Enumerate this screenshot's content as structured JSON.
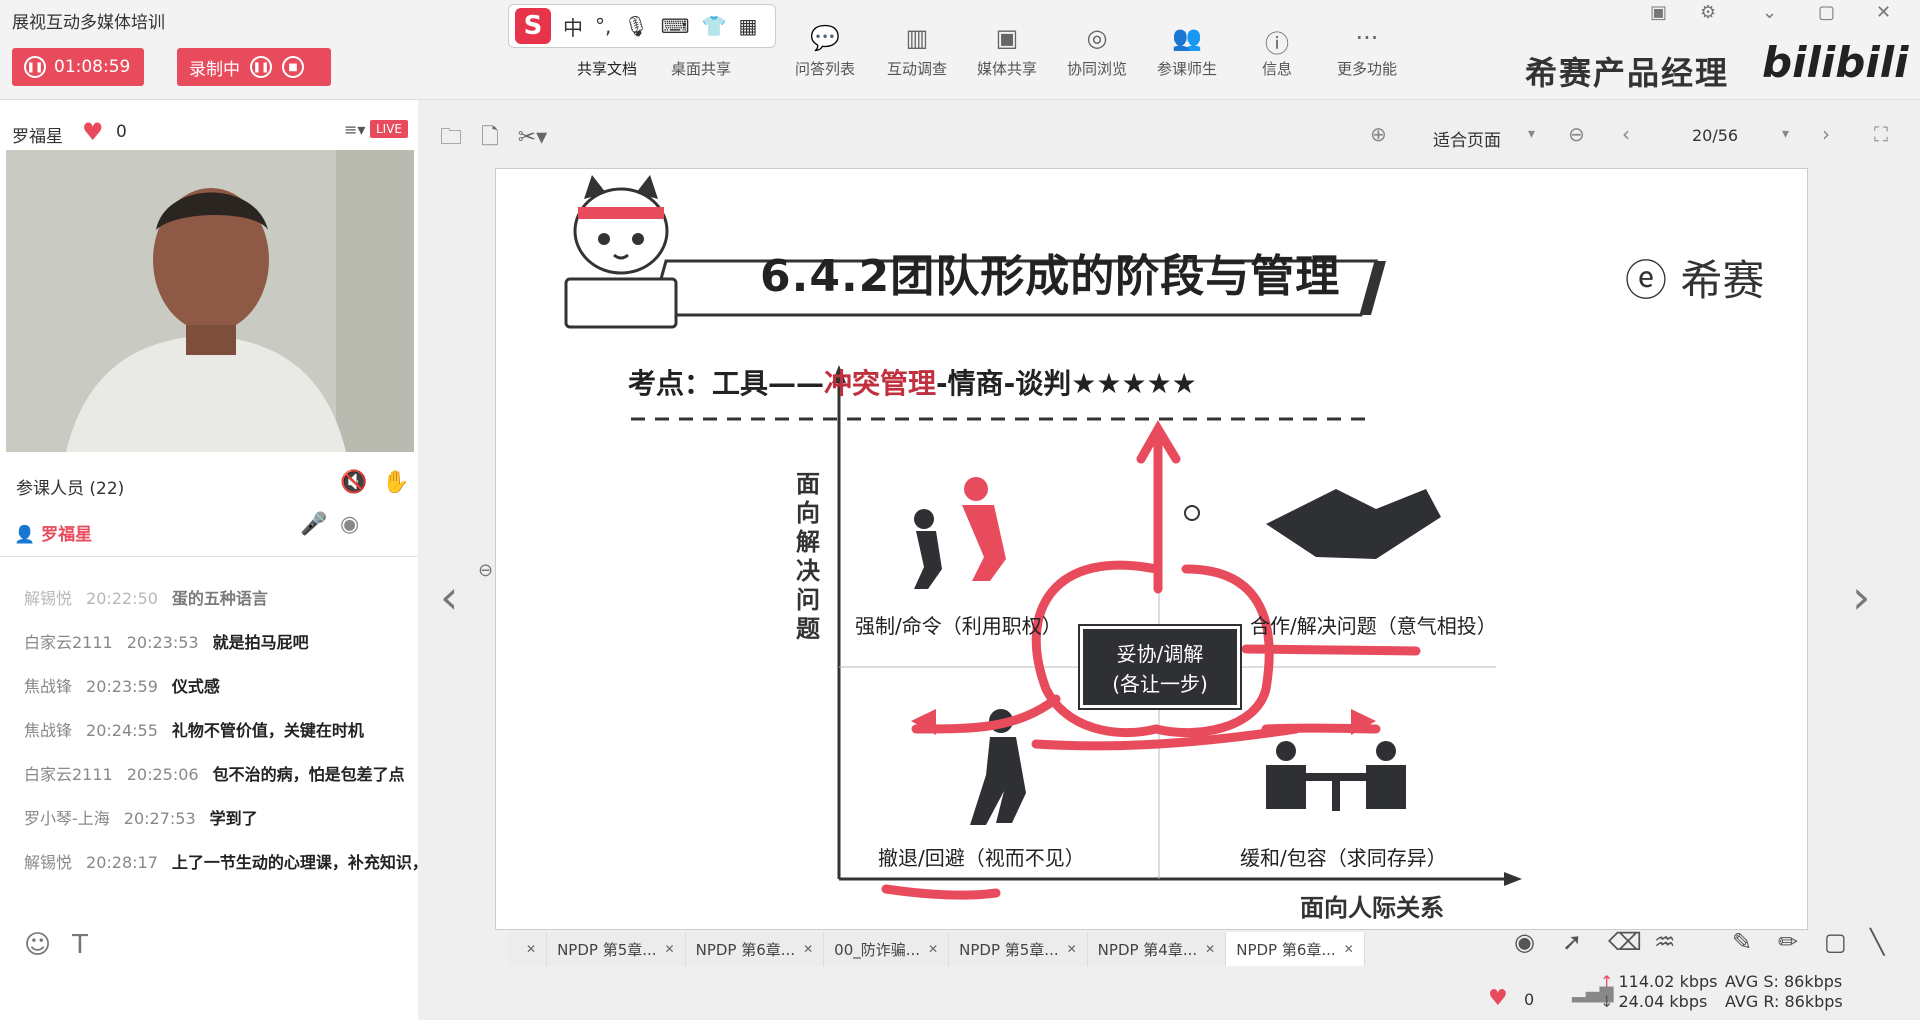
{
  "app": {
    "title": "展视互动多媒体培训",
    "timer": "01:08:59",
    "recording_label": "录制中"
  },
  "ime": {
    "logo": "S",
    "mode": "中",
    "punct": "°,"
  },
  "toolbar": {
    "items": [
      {
        "label": "共享文档",
        "icon": "document-share-icon"
      },
      {
        "label": "桌面共享",
        "icon": "desktop-share-icon"
      },
      {
        "label": "问答列表",
        "icon": "qa-list-icon"
      },
      {
        "label": "互动调查",
        "icon": "survey-icon"
      },
      {
        "label": "媒体共享",
        "icon": "media-share-icon"
      },
      {
        "label": "协同浏览",
        "icon": "co-browse-icon"
      },
      {
        "label": "参课师生",
        "icon": "participants-icon"
      },
      {
        "label": "信息",
        "icon": "info-icon"
      },
      {
        "label": "更多功能",
        "icon": "more-icon"
      }
    ],
    "brand": "希赛产品经理",
    "bili": "bilibili"
  },
  "presenter": {
    "name": "罗福星",
    "likes": "0",
    "live": "LIVE"
  },
  "participants": {
    "title": "参课人员 (22)",
    "list": [
      "罗福星"
    ]
  },
  "chat": {
    "messages": [
      {
        "user": "解锡悦",
        "time": "20:22:50",
        "text": "蛋的五种语言"
      },
      {
        "user": "白家云2111",
        "time": "20:23:53",
        "text": "就是拍马屁吧"
      },
      {
        "user": "焦战锋",
        "time": "20:23:59",
        "text": "仪式感"
      },
      {
        "user": "焦战锋",
        "time": "20:24:55",
        "text": "礼物不管价值，关键在时机"
      },
      {
        "user": "白家云2111",
        "time": "20:25:06",
        "text": "包不治的病，怕是包差了点"
      },
      {
        "user": "罗小琴-上海",
        "time": "20:27:53",
        "text": "学到了"
      },
      {
        "user": "解锡悦",
        "time": "20:28:17",
        "text": "上了一节生动的心理课，补充知识，精彩"
      }
    ]
  },
  "doc": {
    "zoom": "适合页面",
    "page": "20/56"
  },
  "slide": {
    "title": "6.4.2团队形成的阶段与管理",
    "logo": "希赛",
    "kaodian_prefix": "考点：工具——",
    "kaodian_red": "冲突管理",
    "kaodian_suffix": "-情商-谈判★★★★★",
    "y_axis": "面向解决问题",
    "x_axis": "面向人际关系",
    "q_top_left": "强制/命令（利用职权）",
    "q_top_right": "合作/解决问题（意气相投）",
    "q_bottom_left": "撤退/回避（视而不见）",
    "q_bottom_right": "缓和/包容（求同存异）",
    "center_line1": "妥协/调解",
    "center_line2": "(各让一步)"
  },
  "tabs": [
    {
      "label": "",
      "active": false
    },
    {
      "label": "NPDP 第5章...",
      "active": false
    },
    {
      "label": "NPDP 第6章...",
      "active": false
    },
    {
      "label": "00_防诈骗...",
      "active": false
    },
    {
      "label": "NPDP 第5章...",
      "active": false
    },
    {
      "label": "NPDP 第4章...",
      "active": false
    },
    {
      "label": "NPDP 第6章...",
      "active": true
    }
  ],
  "status": {
    "likes": "0",
    "up": "114.02 kbps",
    "down": "24.04 kbps",
    "avg_s": "AVG S: 86kbps",
    "avg_r": "AVG R: 86kbps"
  },
  "colors": {
    "accent": "#e84c5c",
    "brand_red": "#c0303f"
  }
}
